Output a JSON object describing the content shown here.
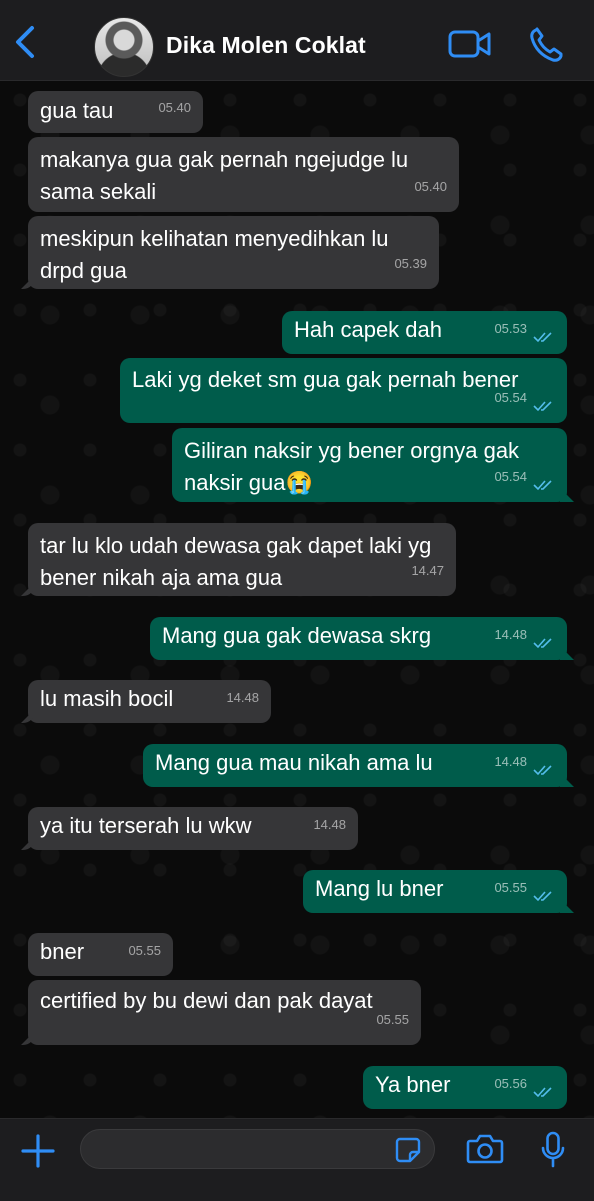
{
  "header": {
    "contact_name": "Dika Molen Coklat"
  },
  "colors": {
    "accent": "#2f8df5",
    "incoming_bubble": "#363638",
    "outgoing_bubble": "#005c4b",
    "read_ticks": "#53bdeb"
  },
  "messages": [
    {
      "direction": "in",
      "text": "gua tau",
      "time": "05.40"
    },
    {
      "direction": "in",
      "text": "makanya gua gak pernah ngejudge lu sama sekali",
      "time": "05.40"
    },
    {
      "direction": "in",
      "text": "meskipun kelihatan menyedihkan lu drpd gua",
      "time": "05.39"
    },
    {
      "direction": "out",
      "text": "Hah capek dah",
      "time": "05.53",
      "status": "read"
    },
    {
      "direction": "out",
      "text": "Laki yg deket sm gua gak pernah bener",
      "time": "05.54",
      "status": "read"
    },
    {
      "direction": "out",
      "text": "Giliran naksir yg bener orgnya gak naksir gua😭",
      "time": "05.54",
      "status": "read"
    },
    {
      "direction": "in",
      "text": "tar lu klo udah dewasa gak dapet laki yg bener nikah aja ama gua",
      "time": "14.47"
    },
    {
      "direction": "out",
      "text": "Mang gua gak dewasa skrg",
      "time": "14.48",
      "status": "read"
    },
    {
      "direction": "in",
      "text": "lu masih bocil",
      "time": "14.48"
    },
    {
      "direction": "out",
      "text": "Mang gua mau nikah ama lu",
      "time": "14.48",
      "status": "read"
    },
    {
      "direction": "in",
      "text": "ya itu terserah lu wkw",
      "time": "14.48"
    },
    {
      "direction": "out",
      "text": "Mang lu bner",
      "time": "05.55",
      "status": "read"
    },
    {
      "direction": "in",
      "text": "bner",
      "time": "05.55"
    },
    {
      "direction": "in",
      "text": "certified by bu dewi dan pak dayat",
      "time": "05.55"
    },
    {
      "direction": "out",
      "text": "Ya bner",
      "time": "05.56",
      "status": "read"
    }
  ],
  "input": {
    "placeholder": "",
    "value": ""
  }
}
